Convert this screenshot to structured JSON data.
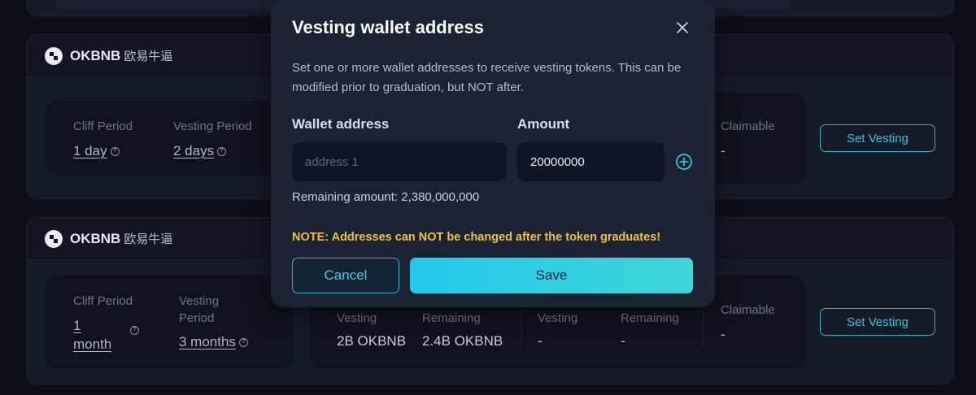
{
  "cards": [
    {
      "token": {
        "symbol": "OKBNB",
        "cn_name": "欧易牛逼"
      },
      "cliff_label": "Cliff Period",
      "cliff_value": "1 day",
      "vesting_label": "Vesting Period",
      "vesting_value": "2 days",
      "claimable_label": "Claimable",
      "claimable_value": "-",
      "set_vesting_label": "Set Vesting"
    },
    {
      "token": {
        "symbol": "OKBNB",
        "cn_name": "欧易牛逼"
      },
      "cliff_label": "Cliff Period",
      "cliff_value_line1": "1",
      "cliff_value_line2": "month",
      "vesting_label_line1": "Vesting",
      "vesting_label_line2": "Period",
      "vesting_value": "3 months",
      "stats": {
        "vesting_label": "Vesting",
        "vesting_value": "2B OKBNB",
        "remaining_label": "Remaining",
        "remaining_value": "2.4B OKBNB",
        "vesting2_label": "Vesting",
        "vesting2_value": "-",
        "remaining2_label": "Remaining",
        "remaining2_value": "-"
      },
      "claimable_label": "Claimable",
      "claimable_value": "-",
      "set_vesting_label": "Set Vesting"
    }
  ],
  "modal": {
    "title": "Vesting wallet address",
    "description": "Set one or more wallet addresses to receive vesting tokens. This can be modified prior to graduation, but NOT after.",
    "wallet_label": "Wallet address",
    "amount_label": "Amount",
    "address_placeholder": "address 1",
    "address_value": "",
    "amount_value": "20000000",
    "remaining_text": "Remaining amount: 2,380,000,000",
    "note": "NOTE: Addresses can NOT be changed after the token graduates!",
    "cancel_label": "Cancel",
    "save_label": "Save"
  },
  "icons": {
    "close": "close-icon",
    "add": "plus-circle-icon",
    "help": "question-circle-icon",
    "token_logo": "okx-logo"
  },
  "colors": {
    "accent": "#23b7cf",
    "save_gradient_start": "#21c9ec",
    "save_gradient_end": "#3ed6d6",
    "warning": "#f2c230",
    "modal_bg": "#1b2234",
    "page_bg": "#0c0f17"
  }
}
